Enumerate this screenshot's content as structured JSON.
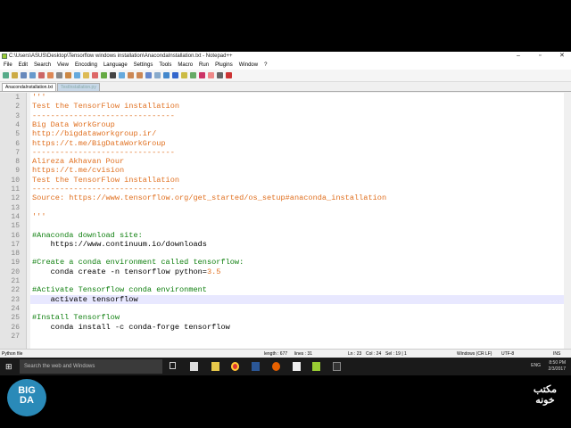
{
  "window": {
    "title": "C:\\Users\\ASUS\\Desktop\\Tensorflow windows installation\\AnacondaInstallation.txt - Notepad++"
  },
  "menu": [
    "File",
    "Edit",
    "Search",
    "View",
    "Encoding",
    "Language",
    "Settings",
    "Tools",
    "Macro",
    "Run",
    "Plugins",
    "Window",
    "?"
  ],
  "tabs": [
    {
      "label": "AnacondaInstallation.txt",
      "active": true
    },
    {
      "label": "TestInstallation.py",
      "active": false
    }
  ],
  "editor": {
    "current_line": 23,
    "lines": [
      {
        "n": "1",
        "t": "'''",
        "c": "doc"
      },
      {
        "n": "2",
        "t": "Test the TensorFlow installation",
        "c": "doc"
      },
      {
        "n": "3",
        "t": "-------------------------------",
        "c": "doc"
      },
      {
        "n": "4",
        "t": "Big Data WorkGroup",
        "c": "doc"
      },
      {
        "n": "5",
        "t": "http://bigdataworkgroup.ir/",
        "c": "doc"
      },
      {
        "n": "6",
        "t": "https://t.me/BigDataWorkGroup",
        "c": "doc"
      },
      {
        "n": "7",
        "t": "-------------------------------",
        "c": "doc"
      },
      {
        "n": "8",
        "t": "Alireza Akhavan Pour",
        "c": "doc"
      },
      {
        "n": "9",
        "t": "https://t.me/cvision",
        "c": "doc"
      },
      {
        "n": "10",
        "t": "Test the TensorFlow installation",
        "c": "doc"
      },
      {
        "n": "11",
        "t": "-------------------------------",
        "c": "doc"
      },
      {
        "n": "12",
        "t": "Source: https://www.tensorflow.org/get_started/os_setup#anaconda_installation",
        "c": "doc"
      },
      {
        "n": "13",
        "t": "",
        "c": ""
      },
      {
        "n": "14",
        "t": "'''",
        "c": "doc"
      },
      {
        "n": "15",
        "t": "",
        "c": ""
      },
      {
        "n": "16",
        "t": "#Anaconda download site:",
        "c": "cm"
      },
      {
        "n": "17",
        "t": "    https://www.continuum.io/downloads",
        "c": ""
      },
      {
        "n": "18",
        "t": "",
        "c": ""
      },
      {
        "n": "19",
        "t": "#Create a conda environment called tensorflow:",
        "c": "cm"
      },
      {
        "n": "20",
        "t": "    conda create -n tensorflow python=",
        "c": "",
        "num": "3.5"
      },
      {
        "n": "21",
        "t": "",
        "c": ""
      },
      {
        "n": "22",
        "t": "#Activate Tensorflow conda environment",
        "c": "cm"
      },
      {
        "n": "23",
        "t": "    activate tensorflow",
        "c": ""
      },
      {
        "n": "24",
        "t": "",
        "c": ""
      },
      {
        "n": "25",
        "t": "#Install Tensorflow",
        "c": "cm"
      },
      {
        "n": "26",
        "t": "    conda install -c conda-forge tensorflow",
        "c": ""
      },
      {
        "n": "27",
        "t": "",
        "c": ""
      }
    ]
  },
  "status": {
    "type": "Python file",
    "length": "length : 677",
    "lines": "lines : 31",
    "pos": "Ln : 23",
    "col": "Col : 24",
    "sel": "Sel : 19 | 1",
    "eol": "Windows (CR LF)",
    "enc": "UTF-8",
    "mode": "INS"
  },
  "taskbar": {
    "search": "Search the web and Windows",
    "lang": "ENG",
    "time": "8:50 PM",
    "date": "2/3/2017"
  },
  "logos": {
    "left": "BIG DA",
    "right": "مکتب خونه"
  }
}
